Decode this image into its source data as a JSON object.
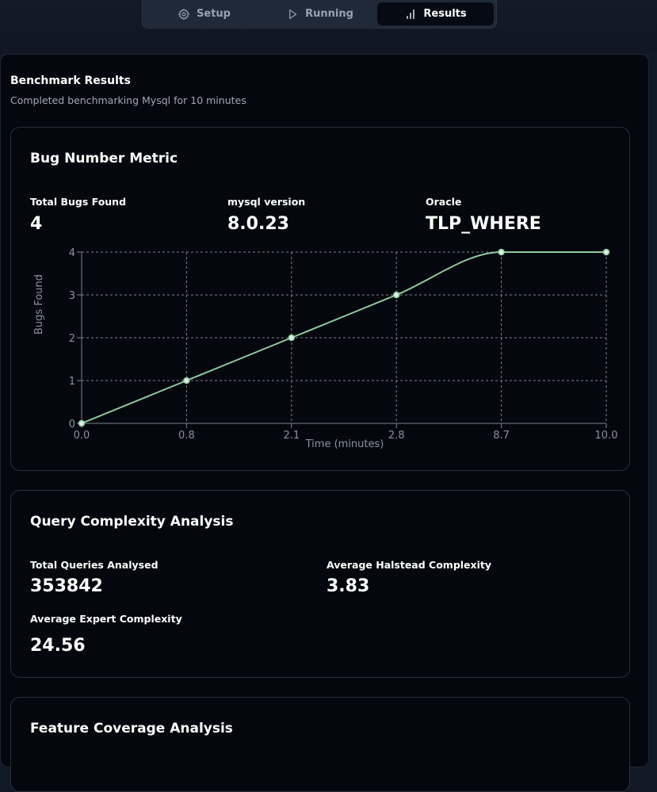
{
  "tabs": [
    {
      "label": "Setup",
      "icon": "gear-icon"
    },
    {
      "label": "Running",
      "icon": "play-icon"
    },
    {
      "label": "Results",
      "icon": "bar-chart-icon",
      "active": true
    }
  ],
  "page": {
    "title": "Benchmark Results",
    "subtitle": "Completed benchmarking Mysql for 10 minutes"
  },
  "bug_card": {
    "title": "Bug Number Metric",
    "metrics": [
      {
        "label": "Total Bugs Found",
        "value": "4"
      },
      {
        "label": "mysql version",
        "value": "8.0.23"
      },
      {
        "label": "Oracle",
        "value": "TLP_WHERE"
      }
    ]
  },
  "chart_data": {
    "type": "line",
    "x_categories": [
      "0.0",
      "0.8",
      "2.1",
      "2.8",
      "8.7",
      "10.0"
    ],
    "y": [
      0,
      1,
      2,
      3,
      4,
      4
    ],
    "xlabel": "Time (minutes)",
    "ylabel": "Bugs Found",
    "y_ticks": [
      "0",
      "1",
      "2",
      "3",
      "4"
    ],
    "ylim": [
      0,
      4
    ],
    "grid": true,
    "line_color": "#8fcaa0"
  },
  "complexity_card": {
    "title": "Query Complexity Analysis",
    "metrics": [
      {
        "label": "Total Queries Analysed",
        "value": "353842"
      },
      {
        "label": "Average Halstead Complexity",
        "value": "3.83"
      },
      {
        "label": "Average Expert Complexity",
        "value": "24.56"
      }
    ]
  },
  "coverage_card": {
    "title": "Feature Coverage Analysis"
  }
}
